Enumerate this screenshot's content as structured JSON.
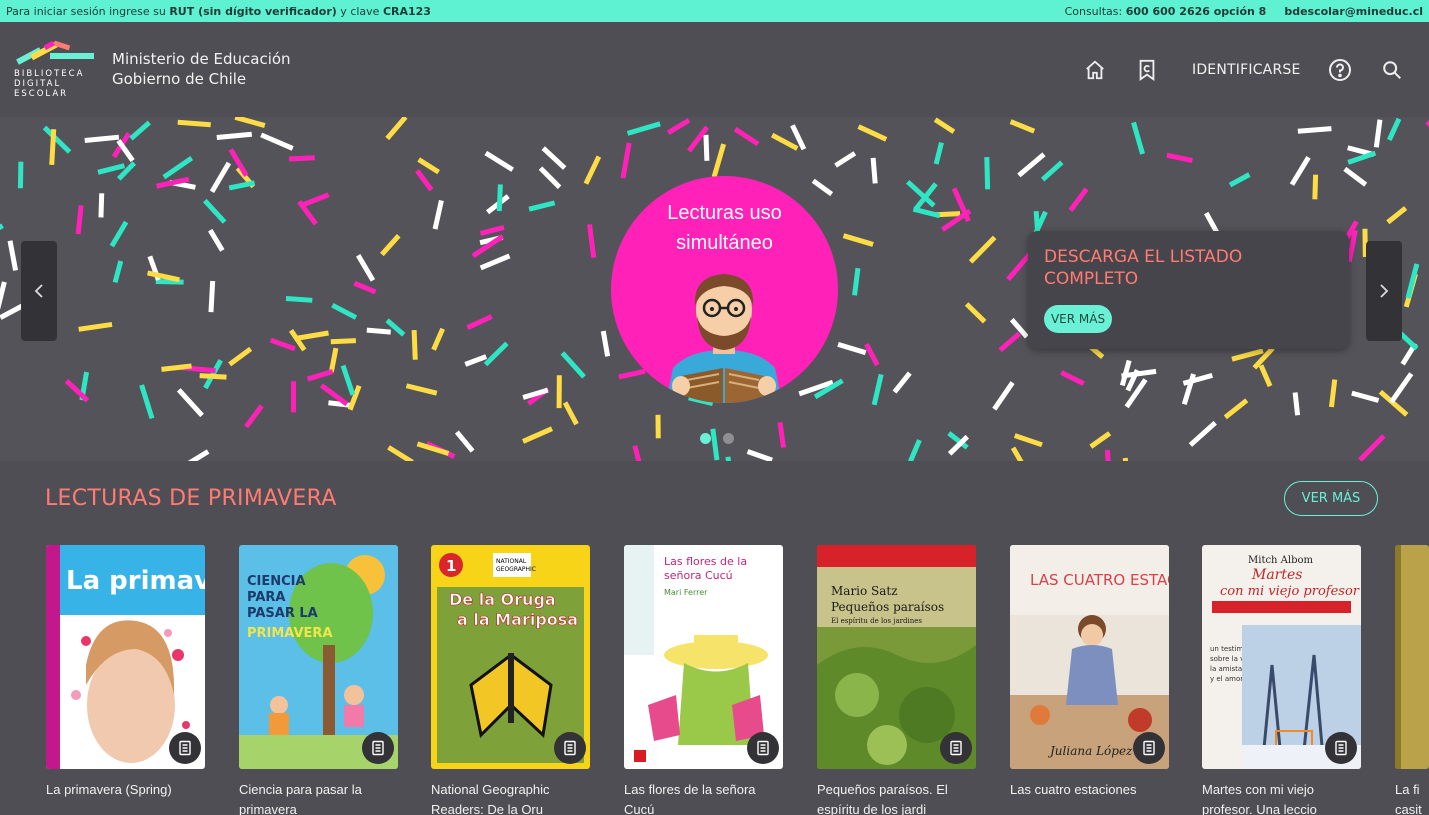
{
  "topbar": {
    "login_pre": "Para iniciar sesión ingrese su ",
    "login_rut": "RUT (sin dígito verificador)",
    "login_mid": " y clave ",
    "login_key": "CRA123",
    "contact_pre": "Consultas: ",
    "contact_phone": "600 600 2626 opción 8",
    "email": "bdescolar@mineduc.cl"
  },
  "header": {
    "logo_lines": [
      "BIBLIOTECA",
      "DIGITAL",
      "ESCOLAR"
    ],
    "ministry_line1": "Ministerio de Educación",
    "ministry_line2": "Gobierno de Chile",
    "login_label": "IDENTIFICARSE"
  },
  "hero": {
    "slide_title_line1": "Lecturas uso",
    "slide_title_line2": "simultáneo",
    "promo_title_line1": "DESCARGA EL LISTADO",
    "promo_title_line2": "COMPLETO",
    "promo_button": "VER MÁS",
    "slides": 2,
    "active_slide": 1
  },
  "section": {
    "title": "LECTURAS DE PRIMAVERA",
    "more_button": "VER MÁS",
    "books": [
      {
        "title_l1": "La primavera (Spring)",
        "title_l2": "",
        "cover_text": "La primavera"
      },
      {
        "title_l1": "Ciencia para pasar la",
        "title_l2": "primavera",
        "cover_text": "CIENCIA PARA PASAR LA PRIMAVERA"
      },
      {
        "title_l1": "National Geographic",
        "title_l2": "Readers: De la Oru",
        "cover_text": "De la Oruga a la Mariposa"
      },
      {
        "title_l1": "Las flores de la señora",
        "title_l2": "Cucú",
        "cover_text": "Las flores de la señora Cucú"
      },
      {
        "title_l1": "Pequeños paraísos. El",
        "title_l2": "espíritu de los jardi",
        "cover_text": "Pequeños paraísos"
      },
      {
        "title_l1": "Las cuatro estaciones",
        "title_l2": "",
        "cover_text": "LAS CUATRO ESTACIONES"
      },
      {
        "title_l1": "Martes con mi viejo",
        "title_l2": "profesor. Una leccio",
        "cover_text": "Martes con mi viejo profesor"
      },
      {
        "title_l1": "La fi",
        "title_l2": "casit",
        "cover_text": ""
      }
    ]
  },
  "colors": {
    "topbar": "#5ff2d2",
    "background": "#4f4e54",
    "accent_coral": "#ff7b73",
    "accent_teal": "#6af0d4",
    "pink": "#ff21b8",
    "yellow": "#fddc46"
  }
}
